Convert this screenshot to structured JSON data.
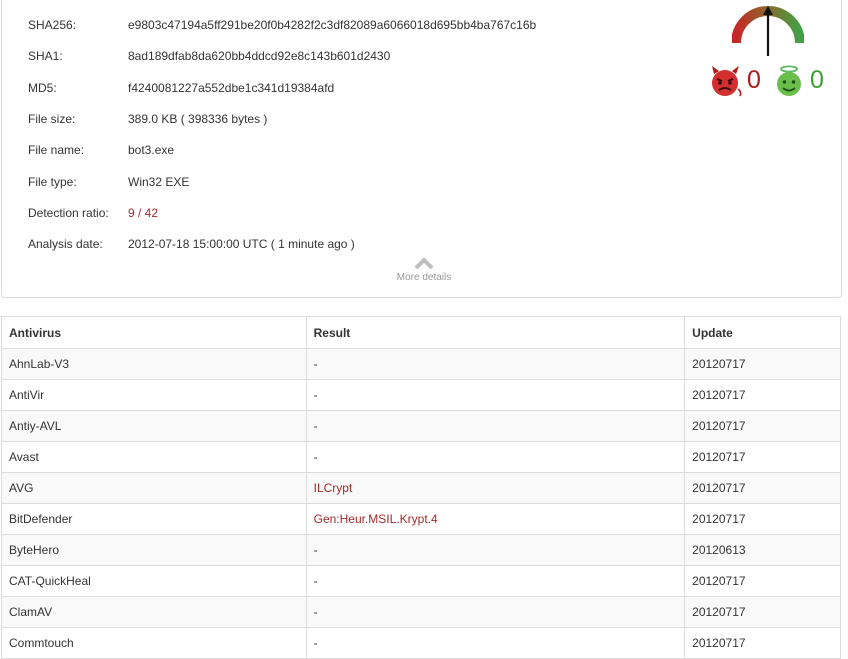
{
  "file_info": {
    "rows": [
      {
        "label": "SHA256:",
        "value": "e9803c47194a5ff291be20f0b4282f2c3df82089a6066018d695bb4ba767c16b"
      },
      {
        "label": "SHA1:",
        "value": "8ad189dfab8da620bb4ddcd92e8c143b601d2430"
      },
      {
        "label": "MD5:",
        "value": "f4240081227a552dbe1c341d19384afd"
      },
      {
        "label": "File size:",
        "value": "389.0 KB ( 398336 bytes )"
      },
      {
        "label": "File name:",
        "value": "bot3.exe"
      },
      {
        "label": "File type:",
        "value": "Win32 EXE"
      },
      {
        "label": "Detection ratio:",
        "value": "9 / 42"
      },
      {
        "label": "Analysis date:",
        "value": "2012-07-18 15:00:00 UTC ( 1 minute ago )"
      }
    ],
    "more_details": "More details"
  },
  "votes": {
    "malicious": "0",
    "harmless": "0",
    "malicious_icon": "devil-face-icon",
    "harmless_icon": "angel-face-icon",
    "gauge_icon": "reputation-gauge-icon",
    "colors": {
      "malicious": "#b11a1a",
      "harmless": "#3ca030"
    }
  },
  "results_table": {
    "headers": {
      "antivirus": "Antivirus",
      "result": "Result",
      "update": "Update"
    },
    "rows": [
      {
        "antivirus": "AhnLab-V3",
        "result": "-",
        "update": "20120717"
      },
      {
        "antivirus": "AntiVir",
        "result": "-",
        "update": "20120717"
      },
      {
        "antivirus": "Antiy-AVL",
        "result": "-",
        "update": "20120717"
      },
      {
        "antivirus": "Avast",
        "result": "-",
        "update": "20120717"
      },
      {
        "antivirus": "AVG",
        "result": "ILCrypt",
        "update": "20120717"
      },
      {
        "antivirus": "BitDefender",
        "result": "Gen:Heur.MSIL.Krypt.4",
        "update": "20120717"
      },
      {
        "antivirus": "ByteHero",
        "result": "-",
        "update": "20120613"
      },
      {
        "antivirus": "CAT-QuickHeal",
        "result": "-",
        "update": "20120717"
      },
      {
        "antivirus": "ClamAV",
        "result": "-",
        "update": "20120717"
      },
      {
        "antivirus": "Commtouch",
        "result": "-",
        "update": "20120717"
      }
    ],
    "detected_color": "#a42a2a"
  }
}
